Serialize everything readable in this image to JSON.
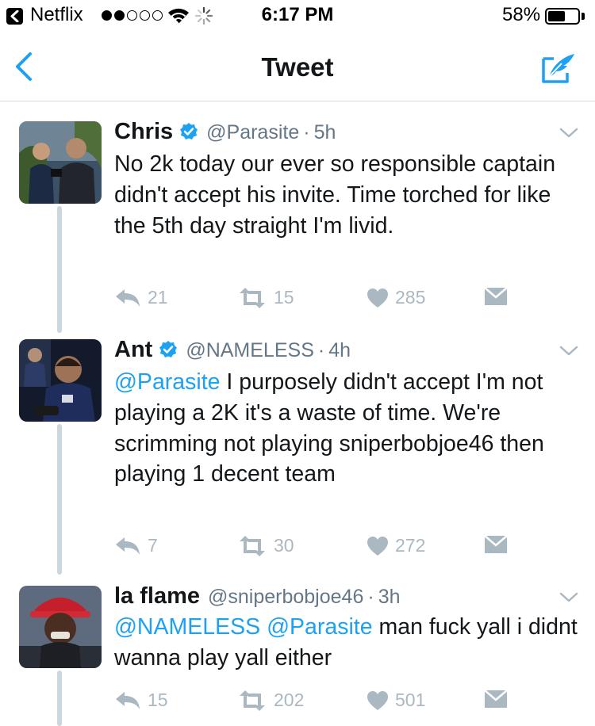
{
  "status_bar": {
    "app": "Netflix",
    "time": "6:17 PM",
    "battery": "58%",
    "battery_level": 0.58,
    "signal_bars": 2
  },
  "nav": {
    "back_icon": "chevron-left-icon",
    "title": "Tweet",
    "compose_icon": "compose-tweet-icon",
    "accent": "#1da1f2"
  },
  "tweets": [
    {
      "name": "Chris",
      "handle": "@Parasite",
      "sep": "·",
      "time": "5h",
      "text": "No 2k today our ever so responsible captain didn't accept his invite. Time torched for like the 5th day straight I'm livid.",
      "replies": "21",
      "retweets": "15",
      "likes": "285"
    },
    {
      "name": "Ant",
      "handle": "@NAMELESS",
      "sep": "·",
      "time": "4h",
      "mentions": "@Parasite",
      "text": " I purposely didn't accept I'm not playing a 2K it's a waste of time. We're scrimming not playing sniperbobjoe46 then playing 1 decent team",
      "replies": "7",
      "retweets": "30",
      "likes": "272"
    },
    {
      "name": "la flame",
      "handle": "@sniperbobjoe46",
      "sep": "·",
      "time": "3h",
      "mention1": "@NAMELESS",
      "mention2": "@Parasite",
      "text": " man fuck yall i didnt wanna play yall either",
      "replies": "15",
      "retweets": "202",
      "likes": "501"
    }
  ]
}
